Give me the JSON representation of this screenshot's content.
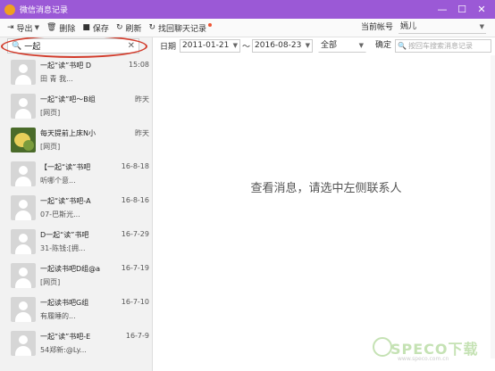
{
  "titlebar": {
    "title": "微信消息记录",
    "min": "—",
    "max": "☐",
    "close": "✕"
  },
  "toolbar": {
    "export": "导出",
    "delete": "删除",
    "save": "保存",
    "refresh": "刷新",
    "retrieve": "找回聊天记录",
    "account_label": "当前帐号",
    "account_value": "嫣儿"
  },
  "search": {
    "value": "一起",
    "clear": "✕"
  },
  "contacts": [
    {
      "name": "一起“读”书吧 D",
      "time": "15:08",
      "preview": "田 青 我..."
    },
    {
      "name": "一起“读”吧～B组",
      "time": "昨天",
      "preview": "[网页]"
    },
    {
      "name": "每天提前上床N小",
      "time": "昨天",
      "preview": "[网页]"
    },
    {
      "name": "【一起“读”书吧",
      "time": "16-8-18",
      "preview": "听哪个意..."
    },
    {
      "name": "一起“读”书吧-A",
      "time": "16-8-16",
      "preview": "07-巴斯光..."
    },
    {
      "name": "D一起“读”书吧",
      "time": "16-7-29",
      "preview": "31-陈钱:[拥..."
    },
    {
      "name": "一起读书吧D组@a",
      "time": "16-7-19",
      "preview": "[网页]"
    },
    {
      "name": "一起读书吧G组",
      "time": "16-7-10",
      "preview": "有履睡的..."
    },
    {
      "name": "一起“读”书吧-E",
      "time": "16-7-9",
      "preview": "54郑新:@Ly..."
    }
  ],
  "filter": {
    "date_label": "日期",
    "start_date": "2011-01-21",
    "tilde": "～",
    "end_date": "2016-08-23",
    "type": "全部",
    "ok": "确定",
    "msg_search_placeholder": "按回车搜索消息记录"
  },
  "main": {
    "empty_message": "查看消息，请选中左侧联系人"
  },
  "watermark": {
    "text": "SPECO下载",
    "sub": "www.speco.com.cn"
  },
  "colors": {
    "titlebar": "#9b59d6",
    "annotation": "#d23b2b"
  }
}
